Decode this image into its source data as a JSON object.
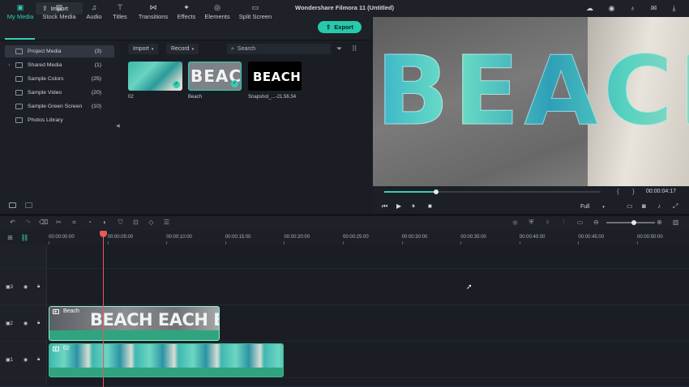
{
  "header": {
    "import_label": "Import",
    "app_title": "Wondershare Filmora 11 (Untitled)",
    "icons": [
      "cloud-icon",
      "account-icon",
      "headset-icon",
      "mail-icon",
      "download-icon"
    ]
  },
  "tabs": [
    {
      "label": "My Media",
      "icon": "folder-icon",
      "active": true
    },
    {
      "label": "Stock Media",
      "icon": "stock-icon"
    },
    {
      "label": "Audio",
      "icon": "music-icon"
    },
    {
      "label": "Titles",
      "icon": "titles-icon"
    },
    {
      "label": "Transitions",
      "icon": "transitions-icon"
    },
    {
      "label": "Effects",
      "icon": "effects-icon"
    },
    {
      "label": "Elements",
      "icon": "elements-icon"
    },
    {
      "label": "Split Screen",
      "icon": "split-screen-icon"
    }
  ],
  "export_label": "Export",
  "sidebar": {
    "items": [
      {
        "label": "Project Media",
        "count": "(3)"
      },
      {
        "label": "Shared Media",
        "count": "(1)"
      },
      {
        "label": "Sample Colors",
        "count": "(25)"
      },
      {
        "label": "Sample Video",
        "count": "(20)"
      },
      {
        "label": "Sample Green Screen",
        "count": "(10)"
      },
      {
        "label": "Photos Library",
        "count": ""
      }
    ]
  },
  "media": {
    "import_dropdown": "Import",
    "record_dropdown": "Record",
    "search_placeholder": "Search",
    "items": [
      {
        "label": "02"
      },
      {
        "label": "Beach",
        "text": "BEACH"
      },
      {
        "label": "Snapshot_...-21.56.34",
        "text": "BEACH"
      }
    ]
  },
  "preview": {
    "overlay_text": "BEACH",
    "progress": 0.24,
    "timecode": "00:00:04:17",
    "quality": "Full",
    "brace_left": "{",
    "brace_right": "}"
  },
  "timeline": {
    "ruler": [
      "00:00:00:00",
      "00:00:05:00",
      "00:00:10:00",
      "00:00:15:00",
      "00:00:20:00",
      "00:00:25:00",
      "00:00:30:00",
      "00:00:35:00",
      "00:00:40:00",
      "00:00:45:00",
      "00:00:50:00"
    ],
    "tracks": [
      {
        "num": "3"
      },
      {
        "num": "2",
        "clip": "Beach",
        "clip_text": "BEACH EACH EA"
      },
      {
        "num": "1",
        "clip": "02"
      }
    ]
  },
  "colors": {
    "accent": "#2fd1b6",
    "playhead": "#e85959",
    "clip": "#2fa57f"
  }
}
